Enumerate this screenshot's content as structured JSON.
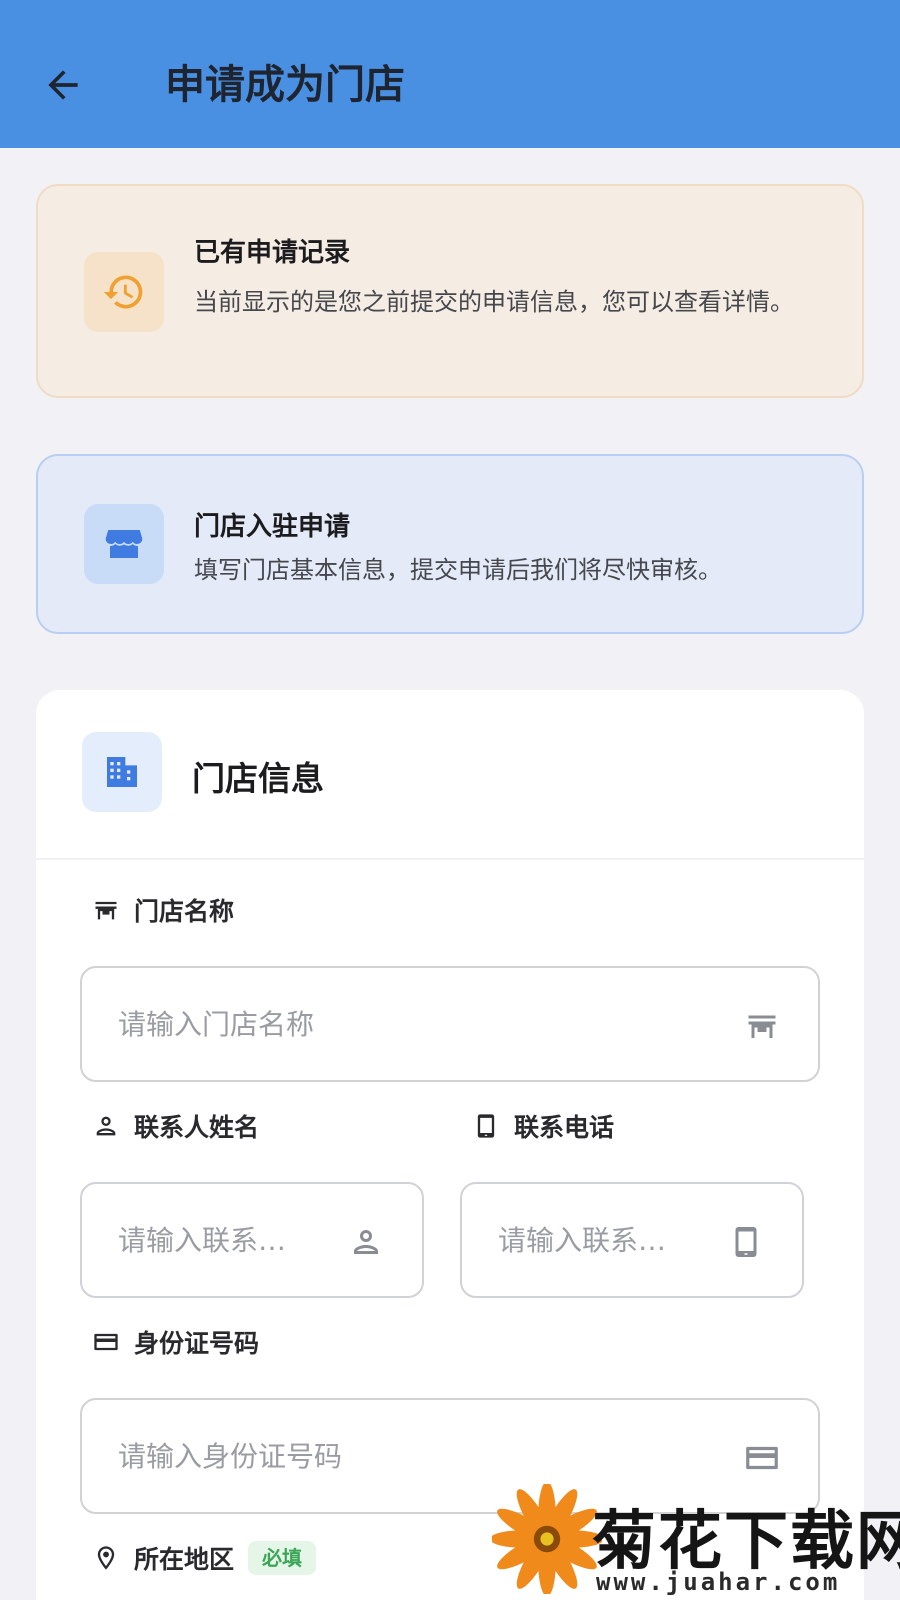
{
  "appbar": {
    "title": "申请成为门店"
  },
  "history_notice": {
    "title": "已有申请记录",
    "desc": "当前显示的是您之前提交的申请信息，您可以查看详情。",
    "icon": "history-icon",
    "accent": "#f0a030"
  },
  "apply_notice": {
    "title": "门店入驻申请",
    "desc": "填写门店基本信息，提交申请后我们将尽快审核。",
    "icon": "store-icon",
    "accent": "#3f7be0"
  },
  "store_card": {
    "title": "门店信息",
    "icon": "building-icon",
    "fields": {
      "store_name": {
        "label": "门店名称",
        "placeholder": "请输入门店名称",
        "icon": "storefront-icon"
      },
      "contact_name": {
        "label": "联系人姓名",
        "placeholder": "请输入联系…",
        "icon": "person-icon"
      },
      "contact_phone": {
        "label": "联系电话",
        "placeholder": "请输入联系…",
        "icon": "phone-icon"
      },
      "id_number": {
        "label": "身份证号码",
        "placeholder": "请输入身份证号码",
        "icon": "id-card-icon"
      },
      "region": {
        "label": "所在地区",
        "badge": "必填",
        "icon": "location-pin-icon"
      }
    }
  },
  "watermark": {
    "brand": "菊花下载网",
    "url": "www.juahar.com"
  },
  "colors": {
    "appbar": "#4a90e2",
    "background": "#f1f1f6",
    "required_badge": "#3aa655"
  }
}
